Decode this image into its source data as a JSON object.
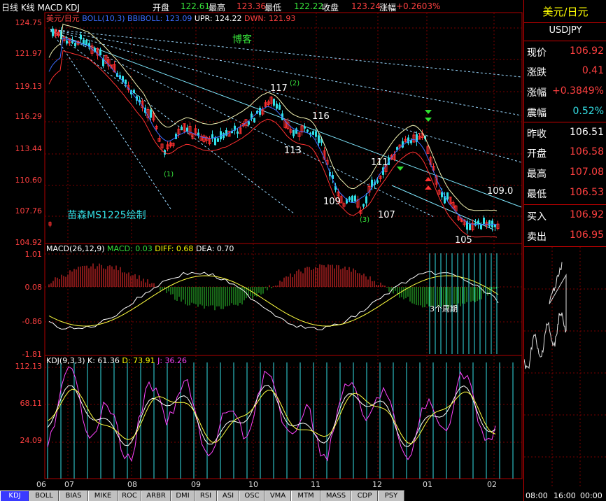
{
  "header": {
    "title": "日线 K线 MACD KDJ",
    "open_label": "开盘",
    "open": "122.61",
    "high_label": "最高",
    "high": "123.36",
    "low_label": "最低",
    "low": "122.22",
    "close_label": "收盘",
    "close": "123.24",
    "change_label": "涨幅",
    "change": "+0.2603%"
  },
  "main_panel": {
    "legend": {
      "name": "美元/日元",
      "boll": "BOLL(10,3) BBIBOLL: 123.09",
      "upr": "UPR: 124.22",
      "dwn": "DWN: 121.93"
    },
    "y_ticks": [
      "124.75",
      "121.97",
      "119.13",
      "116.29",
      "113.44",
      "110.60",
      "107.76",
      "104.92"
    ],
    "annotations": {
      "title_note": "博客",
      "author_note": "苗森MS1225绘制",
      "w117": "117",
      "w2": "(2)",
      "w116": "116",
      "w113": "113",
      "w111": "111",
      "w1": "(1)",
      "w109": "109",
      "w3": "(3)",
      "w107": "107",
      "w105": "105",
      "w1090": "109.0"
    }
  },
  "macd_panel": {
    "legend": {
      "name": "MACD(26,12,9)",
      "macd": "MACD: 0.03",
      "diff": "DIFF: 0.68",
      "dea": "DEA: 0.70"
    },
    "y_ticks": [
      "1.01",
      "0.08",
      "-0.86",
      "-1.81"
    ],
    "note": "3个周期"
  },
  "kdj_panel": {
    "legend": {
      "name": "KDJ(9,3,3)",
      "k": "K: 61.36",
      "d": "D: 73.91",
      "j": "J: 36.26"
    },
    "y_ticks": [
      "112.13",
      "68.11",
      "24.09"
    ]
  },
  "x_axis": {
    "labels": [
      "06",
      "07",
      "08",
      "09",
      "10",
      "11",
      "12",
      "01",
      "02"
    ]
  },
  "quote_panel": {
    "title": "美元/日元",
    "symbol": "USDJPY",
    "rows": [
      {
        "label": "现价",
        "value": "106.92"
      },
      {
        "label": "涨跌",
        "value": "0.41"
      },
      {
        "label": "涨幅",
        "value": "+0.3849%"
      },
      {
        "label": "震幅",
        "value": "0.52%"
      },
      {
        "label": "昨收",
        "value": "106.51"
      },
      {
        "label": "开盘",
        "value": "106.58"
      },
      {
        "label": "最高",
        "value": "107.08"
      },
      {
        "label": "最低",
        "value": "106.53"
      },
      {
        "label": "买入",
        "value": "106.92"
      },
      {
        "label": "卖出",
        "value": "106.95"
      }
    ],
    "time_labels": [
      "08:00",
      "16:00",
      "00:00"
    ]
  },
  "tabs": [
    "KDJ",
    "BOLL",
    "BIAS",
    "MIKE",
    "ROC",
    "ARBR",
    "DMI",
    "RSI",
    "ASI",
    "OSC",
    "VMA",
    "MTM",
    "MASS",
    "CDP",
    "PSY"
  ],
  "active_tab": "KDJ"
}
